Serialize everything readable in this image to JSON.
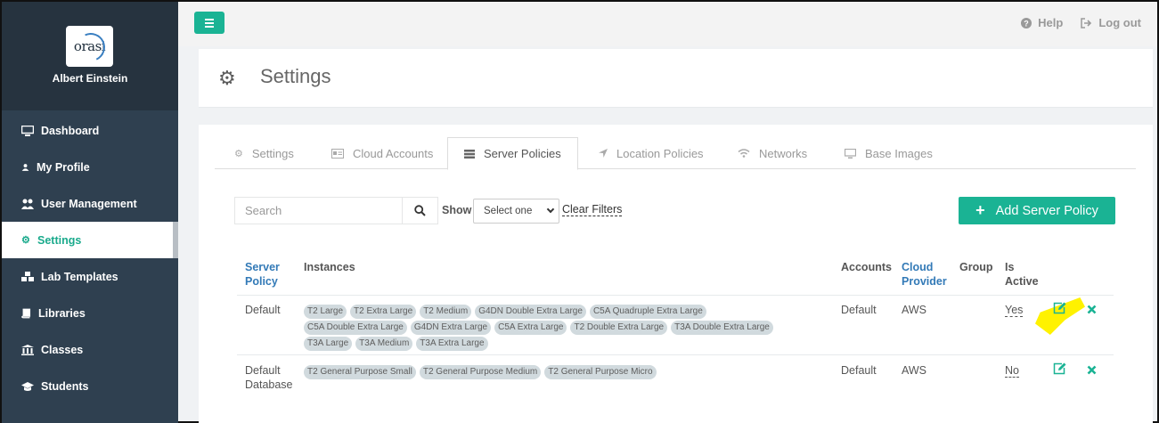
{
  "sidebar": {
    "logo_text": "orasi",
    "user_name": "Albert Einstein",
    "items": [
      {
        "label": "Dashboard",
        "icon": "monitor-icon"
      },
      {
        "label": "My Profile",
        "icon": "user-icon"
      },
      {
        "label": "User Management",
        "icon": "users-icon"
      },
      {
        "label": "Settings",
        "icon": "gear-icon"
      },
      {
        "label": "Lab Templates",
        "icon": "cubes-icon"
      },
      {
        "label": "Libraries",
        "icon": "book-icon"
      },
      {
        "label": "Classes",
        "icon": "bank-icon"
      },
      {
        "label": "Students",
        "icon": "graduation-cap-icon"
      }
    ],
    "active_item": "Settings"
  },
  "topbar": {
    "help_label": "Help",
    "logout_label": "Log out"
  },
  "page": {
    "title": "Settings"
  },
  "tabs": [
    {
      "label": "Settings",
      "icon": "gear-icon"
    },
    {
      "label": "Cloud Accounts",
      "icon": "id-card-icon"
    },
    {
      "label": "Server Policies",
      "icon": "server-icon"
    },
    {
      "label": "Location Policies",
      "icon": "location-arrow-icon"
    },
    {
      "label": "Networks",
      "icon": "wifi-icon"
    },
    {
      "label": "Base Images",
      "icon": "desktop-icon"
    }
  ],
  "active_tab": "Server Policies",
  "filters": {
    "search_placeholder": "Search",
    "show_label": "Show",
    "select_value": "Select one",
    "clear_label": "Clear Filters"
  },
  "add_button_label": "Add Server Policy",
  "table": {
    "headers": {
      "server_policy": "Server Policy",
      "instances": "Instances",
      "accounts": "Accounts",
      "cloud_provider": "Cloud Provider",
      "group": "Group",
      "is_active": "Is Active"
    },
    "rows": [
      {
        "server_policy": "Default",
        "instances": [
          "T2 Large",
          "T2 Extra Large",
          "T2 Medium",
          "G4DN Double Extra Large",
          "C5A Quadruple Extra Large",
          "C5A Double Extra Large",
          "G4DN Extra Large",
          "C5A Extra Large",
          "T2 Double Extra Large",
          "T3A Double Extra Large",
          "T3A Large",
          "T3A Medium",
          "T3A Extra Large"
        ],
        "accounts": "Default",
        "cloud_provider": "AWS",
        "group": "",
        "is_active": "Yes"
      },
      {
        "server_policy": "Default Database",
        "instances": [
          "T2 General Purpose Small",
          "T2 General Purpose Medium",
          "T2 General Purpose Micro"
        ],
        "accounts": "Default",
        "cloud_provider": "AWS",
        "group": "",
        "is_active": "No"
      }
    ]
  },
  "colors": {
    "accent": "#1ab394",
    "sidebar_bg": "#2f4050",
    "link": "#337ab7",
    "highlight": "#fff200"
  }
}
